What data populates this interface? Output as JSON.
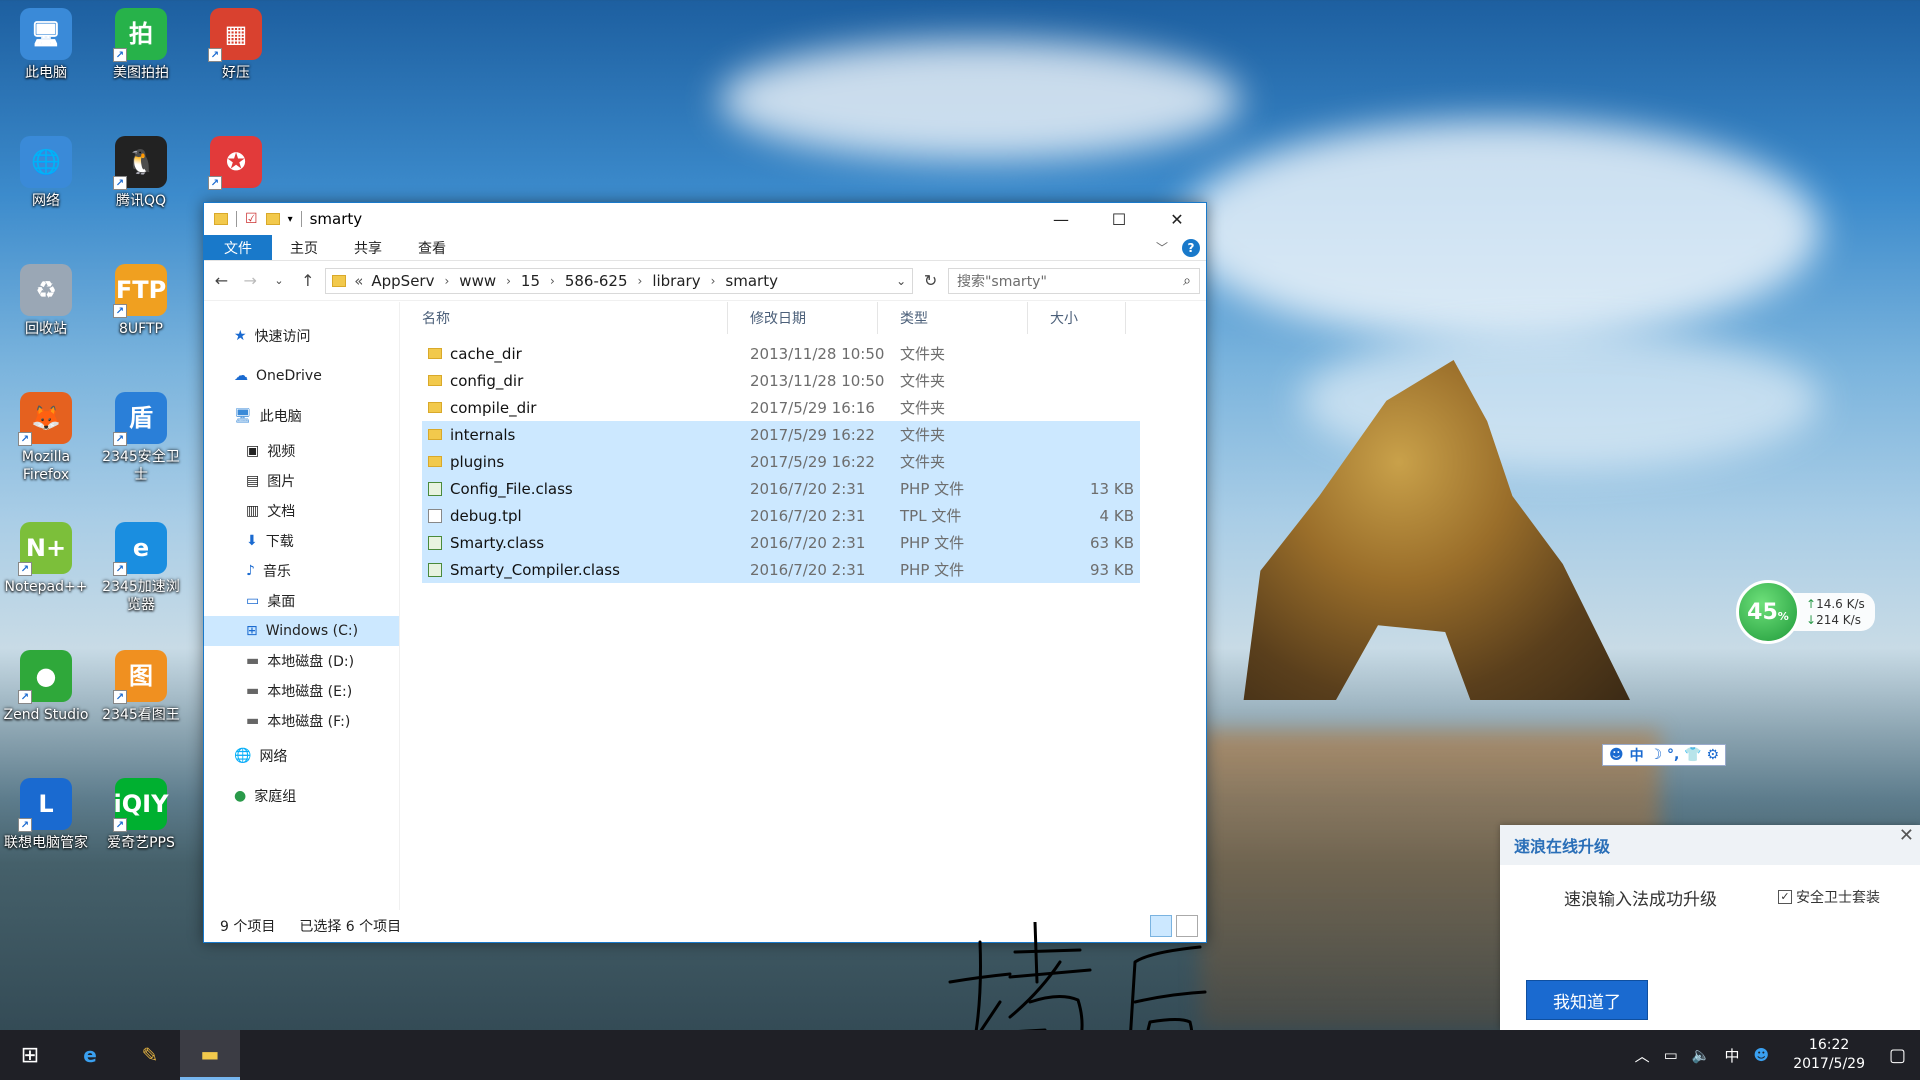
{
  "desktop": {
    "icons": [
      {
        "label": "此电脑",
        "glyph": "🖥",
        "color": "#3a8ad8"
      },
      {
        "label": "美图拍拍",
        "glyph": "拍",
        "color": "#27b24a"
      },
      {
        "label": "好压",
        "glyph": "▦",
        "color": "#d9412f"
      },
      {
        "label": "网络",
        "glyph": "🌐",
        "color": "#3a8ad8"
      },
      {
        "label": "腾讯QQ",
        "glyph": "🐧",
        "color": "#222222"
      },
      {
        "label": "",
        "glyph": "✪",
        "color": "#e23a3a"
      },
      {
        "label": "回收站",
        "glyph": "♻",
        "color": "#9aa7b5"
      },
      {
        "label": "8UFTP",
        "glyph": "FTP",
        "color": "#f0a020"
      },
      {
        "label": "Mozilla Firefox",
        "glyph": "🦊",
        "color": "#e5611f"
      },
      {
        "label": "2345安全卫士",
        "glyph": "盾",
        "color": "#2a7fd8"
      },
      {
        "label": "Notepad++",
        "glyph": "N+",
        "color": "#7cbf3a"
      },
      {
        "label": "2345加速浏览器",
        "glyph": "e",
        "color": "#1a8ee0"
      },
      {
        "label": "Zend Studio",
        "glyph": "●",
        "color": "#2fa83a"
      },
      {
        "label": "2345看图王",
        "glyph": "图",
        "color": "#f09020"
      },
      {
        "label": "联想电脑管家",
        "glyph": "L",
        "color": "#1a6ad0"
      },
      {
        "label": "爱奇艺PPS",
        "glyph": "iQIY",
        "color": "#00b030"
      }
    ]
  },
  "explorer": {
    "title": "smarty",
    "ribbon": {
      "file": "文件",
      "home": "主页",
      "share": "共享",
      "view": "查看",
      "help": "?"
    },
    "breadcrumb": {
      "prefix": "«",
      "items": [
        "AppServ",
        "www",
        "15",
        "586-625",
        "library",
        "smarty"
      ]
    },
    "search_placeholder": "搜索\"smarty\"",
    "sidebar": {
      "quick_access": "快速访问",
      "onedrive": "OneDrive",
      "this_pc": "此电脑",
      "videos": "视频",
      "pictures": "图片",
      "documents": "文档",
      "downloads": "下载",
      "music": "音乐",
      "desktop": "桌面",
      "drive_c": "Windows (C:)",
      "drive_d": "本地磁盘 (D:)",
      "drive_e": "本地磁盘 (E:)",
      "drive_f": "本地磁盘 (F:)",
      "network": "网络",
      "homegroup": "家庭组"
    },
    "columns": {
      "name": "名称",
      "date": "修改日期",
      "type": "类型",
      "size": "大小"
    },
    "files": [
      {
        "name": "cache_dir",
        "date": "2013/11/28 10:50",
        "type": "文件夹",
        "size": "",
        "kind": "folder",
        "selected": false
      },
      {
        "name": "config_dir",
        "date": "2013/11/28 10:50",
        "type": "文件夹",
        "size": "",
        "kind": "folder",
        "selected": false
      },
      {
        "name": "compile_dir",
        "date": "2017/5/29 16:16",
        "type": "文件夹",
        "size": "",
        "kind": "folder",
        "selected": false
      },
      {
        "name": "internals",
        "date": "2017/5/29 16:22",
        "type": "文件夹",
        "size": "",
        "kind": "folder",
        "selected": true
      },
      {
        "name": "plugins",
        "date": "2017/5/29 16:22",
        "type": "文件夹",
        "size": "",
        "kind": "folder",
        "selected": true
      },
      {
        "name": "Config_File.class",
        "date": "2016/7/20 2:31",
        "type": "PHP 文件",
        "size": "13 KB",
        "kind": "php",
        "selected": true
      },
      {
        "name": "debug.tpl",
        "date": "2016/7/20 2:31",
        "type": "TPL 文件",
        "size": "4 KB",
        "kind": "tpl",
        "selected": true
      },
      {
        "name": "Smarty.class",
        "date": "2016/7/20 2:31",
        "type": "PHP 文件",
        "size": "63 KB",
        "kind": "php",
        "selected": true
      },
      {
        "name": "Smarty_Compiler.class",
        "date": "2016/7/20 2:31",
        "type": "PHP 文件",
        "size": "93 KB",
        "kind": "php",
        "selected": true
      }
    ],
    "status": {
      "count": "9 个项目",
      "selected": "已选择 6 个项目"
    }
  },
  "net_widget": {
    "percent": "45",
    "percent_sign": "%",
    "up": "14.6 K/s",
    "down": "214 K/s",
    "up_arrow": "↑",
    "down_arrow": "↓"
  },
  "ime_bar": {
    "mode": "中",
    "symbols": "☽ °, 👕 ⚙"
  },
  "popup": {
    "title": "速浪在线升级",
    "message": "速浪输入法成功升级",
    "checkbox_label": "安全卫士套装",
    "checkbox_checked": true,
    "button": "我知道了",
    "close": "✕"
  },
  "taskbar": {
    "tray_ime": "中",
    "time": "16:22",
    "date": "2017/5/29"
  }
}
